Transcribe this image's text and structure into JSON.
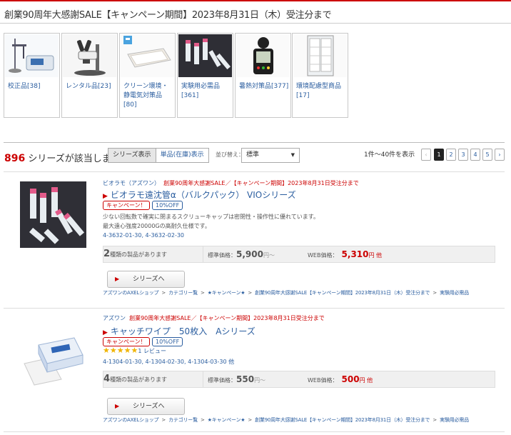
{
  "page": {
    "title": "創業90周年大感謝SALE【キャンペーン期間】2023年8月31日（木）受注分まで"
  },
  "categories": [
    {
      "label": "校正品[38]",
      "icon": "meter-icon"
    },
    {
      "label": "レンタル品[23]",
      "icon": "microscope-icon"
    },
    {
      "label": "クリーン環境・静電気対策品[80]",
      "icon": "clean-tray-icon"
    },
    {
      "label": "実験用必需品[361]",
      "icon": "tubes-icon"
    },
    {
      "label": "暑熱対策品[377]",
      "icon": "heat-meter-icon"
    },
    {
      "label": "環境配慮型商品[17]",
      "icon": "cabinet-icon"
    }
  ],
  "results": {
    "count": "896",
    "count_suffix": "シリーズが該当します",
    "view_series": "シリーズ表示",
    "view_single": "単品(在庫)表示",
    "sort_label": "並び替え：",
    "sort_value": "標準",
    "range_text": "1件～40件を表示",
    "pages": [
      "1",
      "2",
      "3",
      "4",
      "5"
    ],
    "prev": "‹",
    "next": "›"
  },
  "products": [
    {
      "brand": "ビオラモ（アズワン）",
      "campaign": "創業90周年大感謝SALE／【キャンペーン期間】2023年8月31日受注分まで",
      "name": "ビオラモ遠沈管α（バルクパック） VIOシリーズ",
      "tag_campaign": "キャンペーン！",
      "tag_discount": "10%OFF",
      "desc1": "少ない回転数で確実に閉まるスクリューキャップは密閉性・操作性に優れています。",
      "desc2": "最大遠心強度20000Gの高耐久仕様です。",
      "codes": "4-3632-01-30, 4-3632-02-30",
      "variants_num": "2",
      "variants_text": "種類の製品があります",
      "std_label": "標準価格：",
      "std_price": "5,900",
      "std_unit": "円～",
      "web_label": "WEB価格：",
      "web_price": "5,310",
      "web_unit": "円 他",
      "button": "シリーズへ",
      "breadcrumb": [
        "アズワンのAXELショップ",
        ">",
        "カテゴリー覧",
        ">",
        "★キャンペーン★",
        ">",
        "創業90周年大感謝SALE【キャンペーン期間】2023年8月31日（木）受注分まで",
        ">",
        "実験用必需品"
      ]
    },
    {
      "brand": "アズワン",
      "campaign": "創業90周年大感謝SALE／【キャンペーン期間】2023年8月31日受注分まで",
      "name": "キャッチワイプ　50枚入　Aシリーズ",
      "tag_campaign": "キャンペーン！",
      "tag_discount": "10%OFF",
      "stars": "★★★★★",
      "review": "1 レビュー",
      "codes": "4-1304-01-30, 4-1304-02-30, 4-1304-03-30 他",
      "variants_num": "4",
      "variants_text": "種類の製品があります",
      "std_label": "標準価格：",
      "std_price": "550",
      "std_unit": "円～",
      "web_label": "WEB価格：",
      "web_price": "500",
      "web_unit": "円 他",
      "button": "シリーズへ",
      "breadcrumb": [
        "アズワンのAXELショップ",
        ">",
        "カテゴリー覧",
        ">",
        "★キャンペーン★",
        ">",
        "創業90周年大感謝SALE【キャンペーン期間】2023年8月31日（木）受注分まで",
        ">",
        "実験用必需品"
      ]
    }
  ],
  "colors": {
    "accent_red": "#cc0000",
    "link_blue": "#2a5d9f",
    "star_gold": "#f0b400"
  }
}
